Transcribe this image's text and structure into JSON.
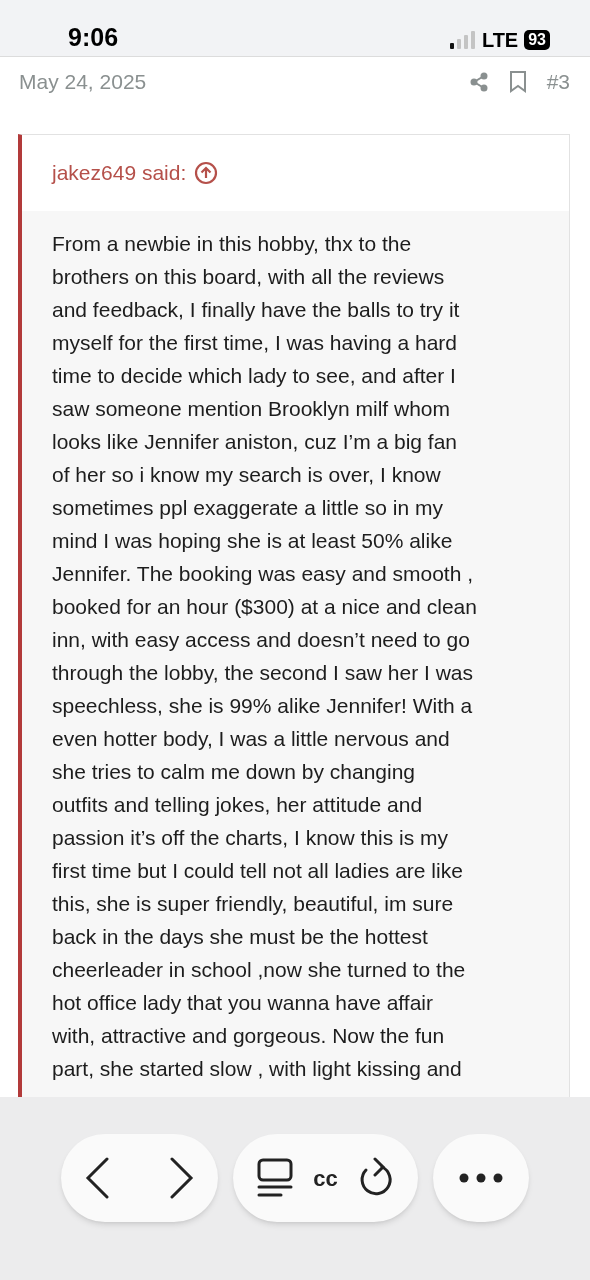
{
  "status_bar": {
    "time": "9:06",
    "network": "LTE",
    "battery": "93"
  },
  "post": {
    "date": "May 24, 2025",
    "number": "#3",
    "quote": {
      "author_line": "jakez649 said:",
      "lines": [
        "From a newbie in this hobby, thx to the",
        "brothers on this board, with all the reviews",
        "and feedback, I finally have the balls to try it",
        "myself for the first time, I was having a hard",
        "time to decide which lady to see, and after I",
        "saw someone mention Brooklyn milf whom",
        "looks like Jennifer aniston, cuz I’m a big fan",
        "of her so i know my search is over, I know",
        "sometimes ppl exaggerate a little so in my",
        "mind I was hoping she is at least 50% alike",
        "Jennifer. The booking was easy and smooth ,",
        "booked for an hour ($300) at a nice and clean",
        "inn, with easy access and doesn’t need to go",
        "through the lobby, the second I saw her I was",
        "speechless, she is 99% alike Jennifer! With a",
        "even hotter body, I was a little nervous and",
        "she tries to calm me down by changing",
        "outfits and telling jokes, her attitude and",
        "passion it’s off the charts, I know this is my",
        "first time but I could tell not all ladies are like",
        "this, she is super friendly, beautiful, im sure",
        "back in the days she must be the hottest",
        "cheerleader in school ,now she turned to the",
        "hot office lady that you wanna have affair",
        "with, attractive and gorgeous. Now the fun",
        "part, she started slow , with light kissing and"
      ]
    }
  },
  "toolbar": {
    "address": "cc"
  }
}
